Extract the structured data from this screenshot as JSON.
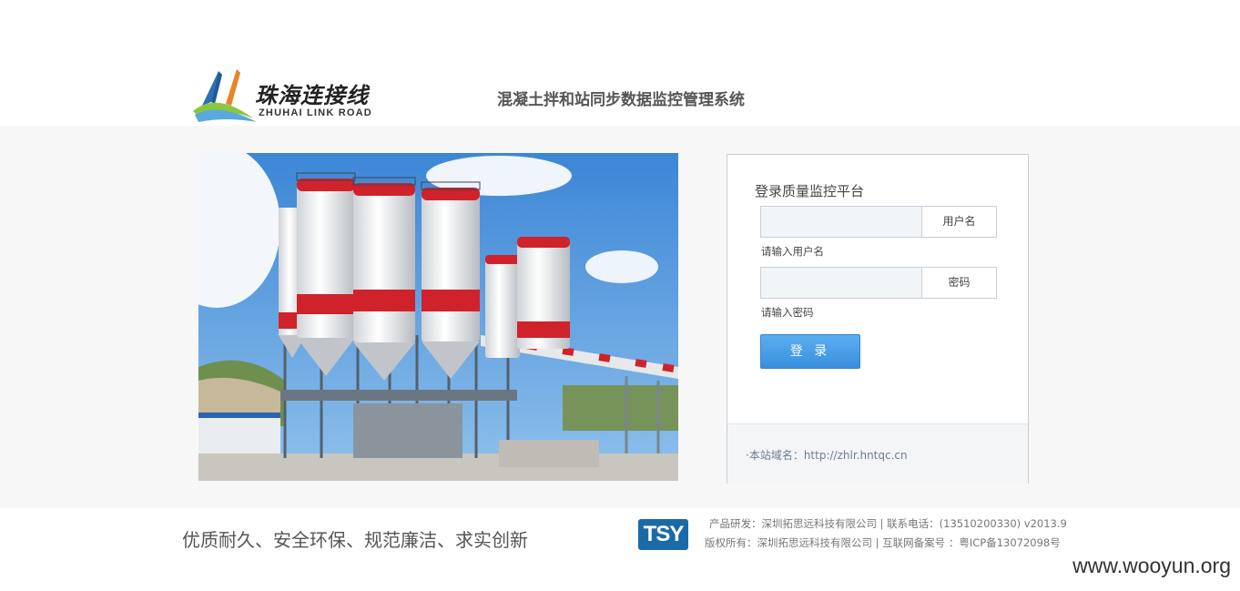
{
  "header": {
    "logo_cn": "珠海连接线",
    "logo_en": "ZHUHAI LINK ROAD",
    "system_title": "混凝土拌和站同步数据监控管理系统"
  },
  "login": {
    "title": "登录质量监控平台",
    "username_addon": "用户名",
    "username_hint": "请输入用户名",
    "password_addon": "密码",
    "password_hint": "请输入密码",
    "username_value": "",
    "password_value": "",
    "submit_label": "登 录",
    "domain_text": "·本站域名：http://zhlr.hntqc.cn"
  },
  "footer": {
    "slogan": "优质耐久、安全环保、规范廉洁、求实创新",
    "tsy_logo": "TSY",
    "dev_line": "产品研发：深圳拓思远科技有限公司 | 联系电话：(13510200330)  v2013.9",
    "copyright_line": "版权所有：深圳拓思远科技有限公司  | 互联网备案号  ：粤ICP备13072098号"
  },
  "watermark": "www.wooyun.org",
  "colors": {
    "accent_blue": "#3a8fde",
    "silo_red": "#d0222a",
    "band_bg": "#f7f7f7"
  }
}
